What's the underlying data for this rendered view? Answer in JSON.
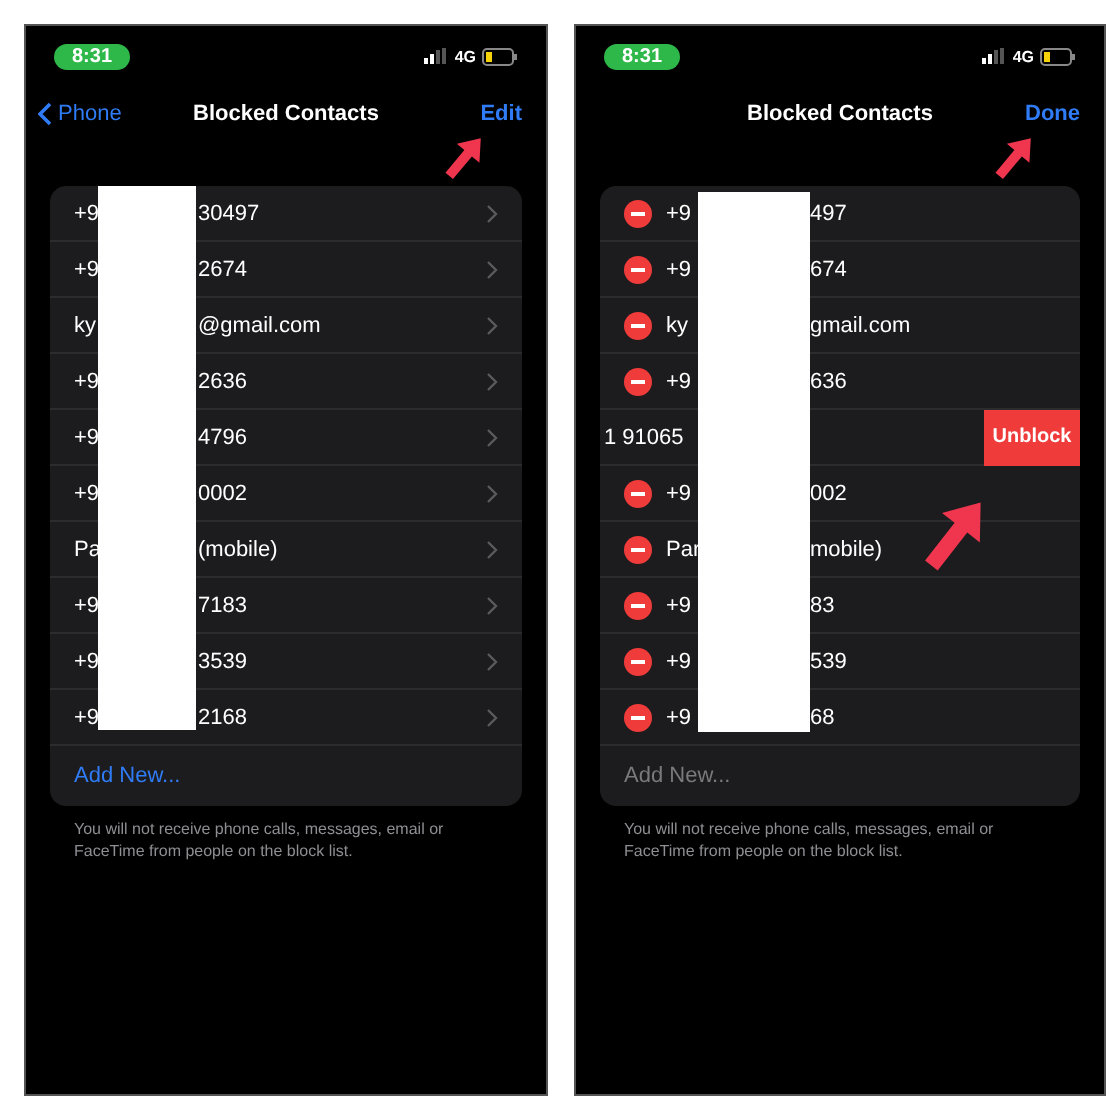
{
  "screens": [
    {
      "status_bar": {
        "time": "8:31",
        "network": "4G"
      },
      "nav": {
        "back": "Phone",
        "title": "Blocked Contacts",
        "action": "Edit"
      },
      "editing": false,
      "contacts": [
        {
          "visible_start": "+9",
          "visible_end": "30497",
          "swiped": false
        },
        {
          "visible_start": "+9",
          "visible_end": "2674",
          "swiped": false
        },
        {
          "visible_start": "ky",
          "visible_end": "@gmail.com",
          "swiped": false
        },
        {
          "visible_start": "+9",
          "visible_end": "2636",
          "swiped": false
        },
        {
          "visible_start": "+9",
          "visible_end": "4796",
          "swiped": false
        },
        {
          "visible_start": "+9",
          "visible_end": "0002",
          "swiped": false
        },
        {
          "visible_start": "Pa",
          "visible_end": "(mobile)",
          "swiped": false
        },
        {
          "visible_start": "+9",
          "visible_end": "7183",
          "swiped": false
        },
        {
          "visible_start": "+9",
          "visible_end": "3539",
          "swiped": false
        },
        {
          "visible_start": "+9",
          "visible_end": "2168",
          "swiped": false
        }
      ],
      "add_new": {
        "label": "Add New...",
        "disabled": false
      },
      "footer": "You will not receive phone calls, messages, email or FaceTime from people on the block list.",
      "pointers": [
        {
          "kind": "nav-action"
        }
      ]
    },
    {
      "status_bar": {
        "time": "8:31",
        "network": "4G"
      },
      "nav": {
        "title": "Blocked Contacts",
        "action": "Done"
      },
      "editing": true,
      "contacts": [
        {
          "visible_start": "+9",
          "visible_end": "497",
          "swiped": false
        },
        {
          "visible_start": "+9",
          "visible_end": "674",
          "swiped": false
        },
        {
          "visible_start": "ky",
          "visible_end": "gmail.com",
          "swiped": false
        },
        {
          "visible_start": "+9",
          "visible_end": "636",
          "swiped": false
        },
        {
          "visible_start": "1 91065",
          "swiped": true,
          "action": "Unblock"
        },
        {
          "visible_start": "+9",
          "visible_end": "002",
          "swiped": false
        },
        {
          "visible_start": "Par",
          "visible_end": "mobile)",
          "swiped": false
        },
        {
          "visible_start": "+9",
          "visible_end": "83",
          "swiped": false
        },
        {
          "visible_start": "+9",
          "visible_end": "539",
          "swiped": false
        },
        {
          "visible_start": "+9",
          "visible_end": "68",
          "swiped": false
        }
      ],
      "add_new": {
        "label": "Add New...",
        "disabled": true
      },
      "footer": "You will not receive phone calls, messages, email or FaceTime from people on the block list.",
      "pointers": [
        {
          "kind": "nav-action"
        },
        {
          "kind": "unblock"
        }
      ]
    }
  ]
}
